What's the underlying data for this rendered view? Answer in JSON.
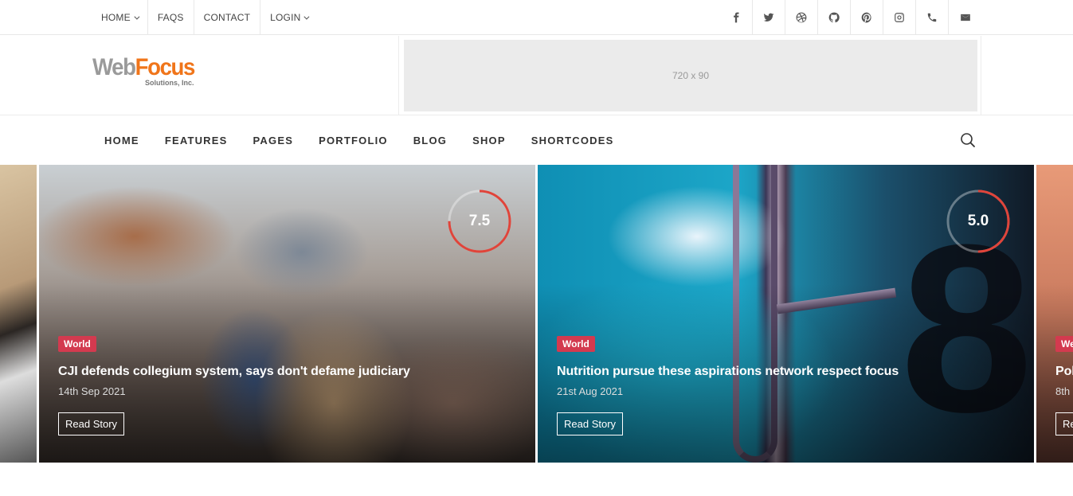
{
  "topnav": {
    "items": [
      {
        "label": "HOME",
        "dropdown": true
      },
      {
        "label": "FAQS",
        "dropdown": false
      },
      {
        "label": "CONTACT",
        "dropdown": false
      },
      {
        "label": "LOGIN",
        "dropdown": true
      }
    ],
    "social_icons": [
      "facebook-icon",
      "twitter-icon",
      "dribbble-icon",
      "github-icon",
      "pinterest-icon",
      "instagram-icon",
      "phone-icon",
      "mail-icon"
    ]
  },
  "header": {
    "logo": {
      "part1": "Web",
      "part2": "Focus",
      "sub": "Solutions, Inc."
    },
    "ad_label": "720 x 90"
  },
  "mainnav": {
    "items": [
      "HOME",
      "FEATURES",
      "PAGES",
      "PORTFOLIO",
      "BLOG",
      "SHOP",
      "SHORTCODES"
    ]
  },
  "slides": [
    {
      "category": "World",
      "title": "CJI defends collegium system, says don't defame judiciary",
      "date": "14th Sep 2021",
      "button": "Read Story",
      "score": "7.5",
      "score_fraction": 0.75
    },
    {
      "category": "World",
      "title": "Nutrition pursue these aspirations network respect focus",
      "date": "21st Aug 2021",
      "button": "Read Story",
      "score": "5.0",
      "score_fraction": 0.5
    },
    {
      "category": "We",
      "title": "Pol",
      "date": "8th",
      "button": "Re"
    }
  ],
  "colors": {
    "category_badge": "#d33a4f",
    "score_ring": "#e0443a",
    "logo_focus": "#f0751a"
  }
}
